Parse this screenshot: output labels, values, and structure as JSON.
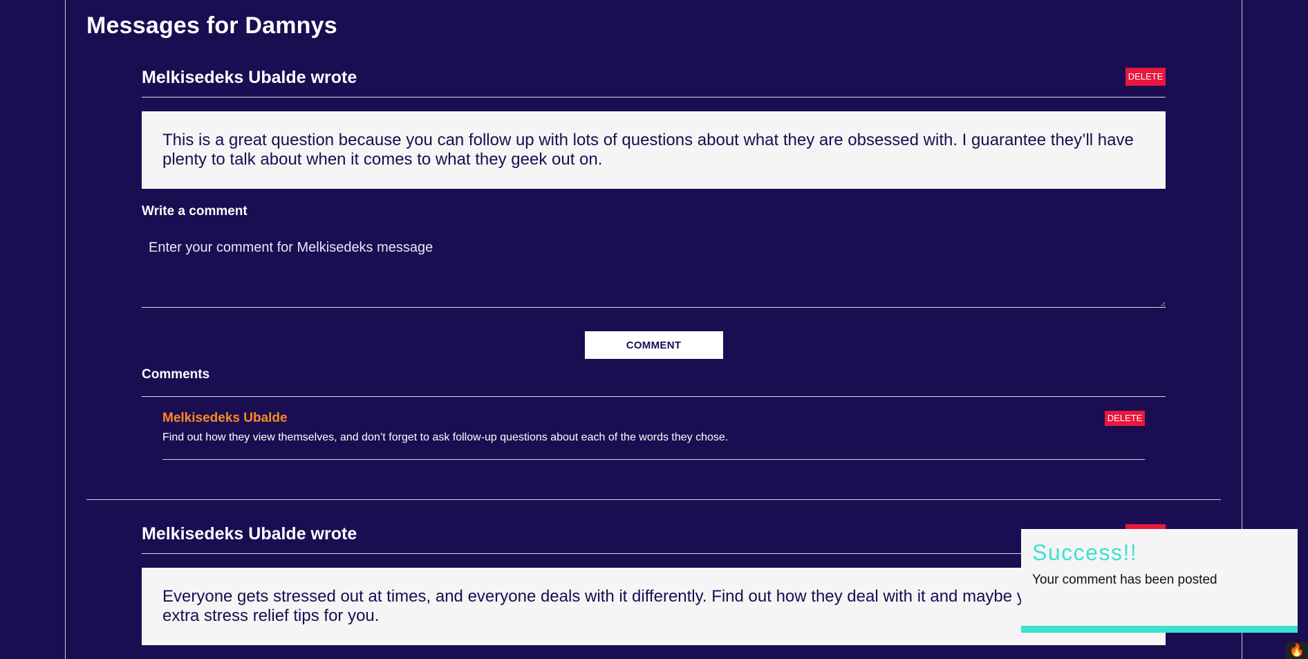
{
  "page": {
    "title": "Messages for Damnys"
  },
  "posts": [
    {
      "author_line": "Melkisedeks Ubalde wrote",
      "delete_label": "DELETE",
      "message": "This is a great question because you can follow up with lots of questions about what they are obsessed with. I guarantee they’ll have plenty to talk about when it comes to what they geek out on.",
      "comment_form": {
        "label": "Write a comment",
        "placeholder": "Enter your comment for Melkisedeks message",
        "value": "",
        "submit_label": "COMMENT"
      },
      "comments_title": "Comments",
      "comments": [
        {
          "author": "Melkisedeks Ubalde",
          "text": "Find out how they view themselves, and don’t forget to ask follow-up questions about each of the words they chose.",
          "delete_label": "DELETE"
        }
      ]
    },
    {
      "author_line": "Melkisedeks Ubalde wrote",
      "delete_label": "DELETE",
      "message": "Everyone gets stressed out at times, and everyone deals with it differently. Find out how they deal with it and maybe you’ll find some extra stress relief tips for you."
    }
  ],
  "toast": {
    "title": "Success!!",
    "body": "Your comment has been posted",
    "accent_color": "#3fe0cf"
  },
  "colors": {
    "background": "#1a0d52",
    "delete": "#e8173e",
    "comment_author": "#ff8a1f"
  },
  "icons": {
    "corner": "flame-icon"
  }
}
